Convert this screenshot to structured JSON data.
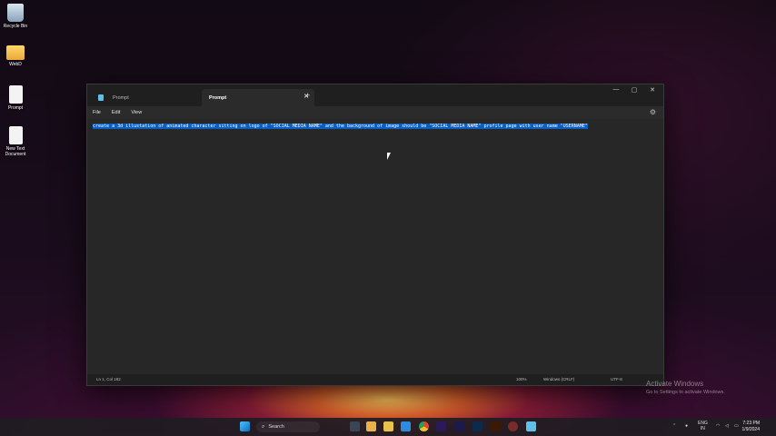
{
  "desktop": {
    "icons": [
      {
        "label": "Recycle Bin"
      },
      {
        "label": "WebD"
      },
      {
        "label": "Prompt"
      },
      {
        "label": "New Text Document"
      }
    ]
  },
  "window": {
    "tabs": [
      {
        "label": "Prompt"
      },
      {
        "label": "Prompt"
      }
    ],
    "new_tab": "+",
    "controls": {
      "minimize": "—",
      "maximize": "▢",
      "close": "✕"
    },
    "menu": [
      "File",
      "Edit",
      "View"
    ],
    "content": "create a 3d illustation of animated character sitting on logo of \"SOCIAL MEDIA NAME\" and the background of image should be \"SOCIAL MEDIA NAME\" profile page with user name \"USERNAME\"",
    "status": {
      "position": "Ln 1, Col 182",
      "zoom": "100%",
      "line_ending": "Windows (CRLF)",
      "encoding": "UTF-8"
    }
  },
  "watermark": {
    "title": "Activate Windows",
    "subtitle": "Go to Settings to activate Windows."
  },
  "taskbar": {
    "search_label": "Search",
    "apps": [
      "files-icon",
      "explorer-icon",
      "store-icon",
      "vscode-icon",
      "chrome-icon",
      "premiere-icon",
      "aftereffects-icon",
      "photoshop-icon",
      "illustrator-icon",
      "browser-icon",
      "notepad-icon"
    ],
    "lang_line1": "ENG",
    "lang_line2": "IN",
    "time": "7:23 PM",
    "date": "1/9/2024"
  }
}
